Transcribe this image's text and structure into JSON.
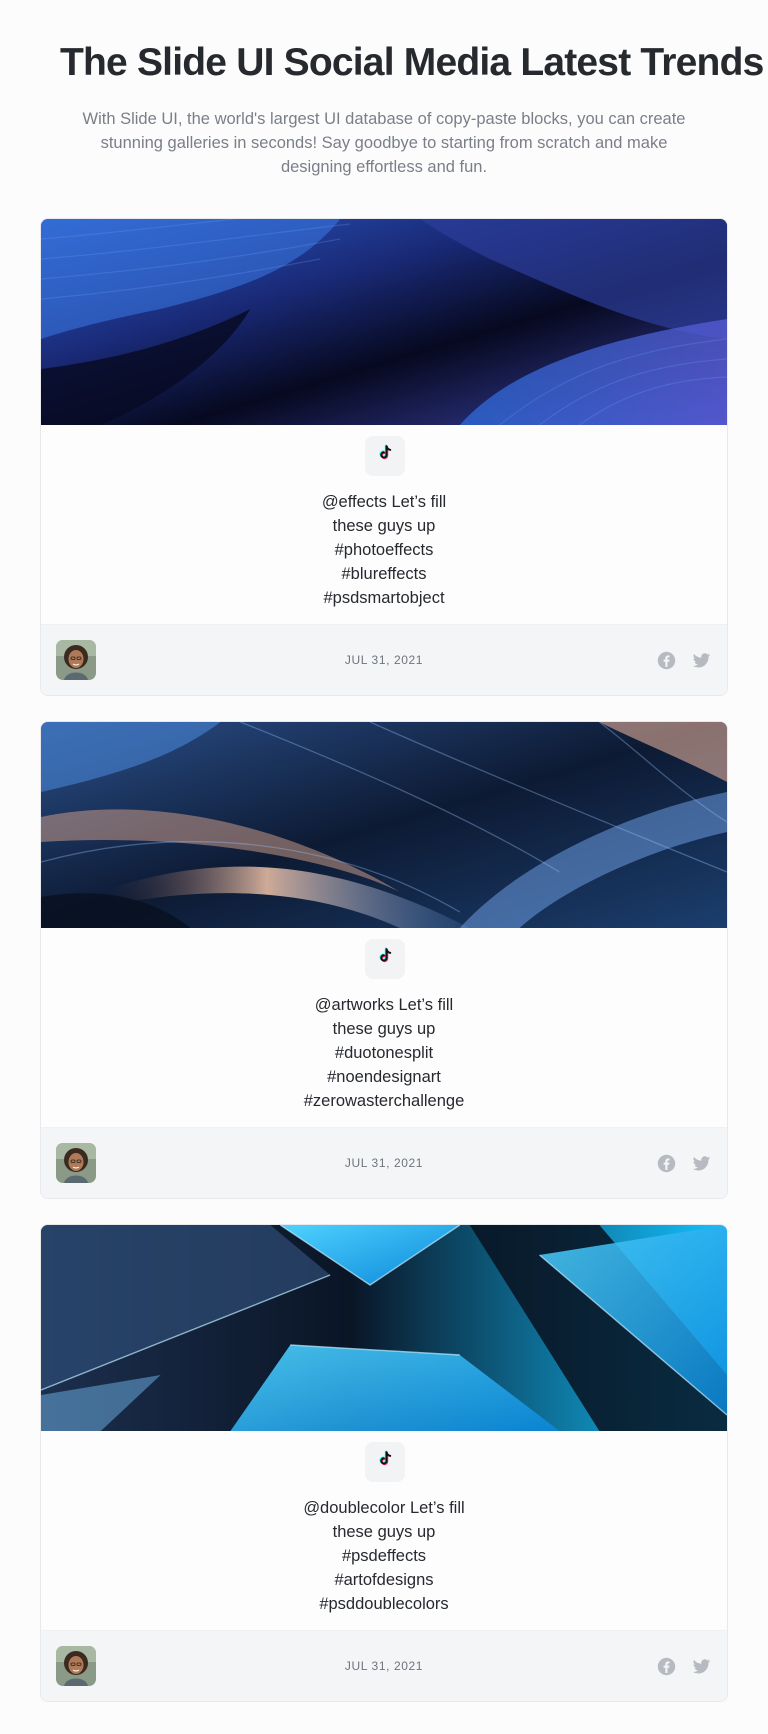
{
  "header": {
    "title": "The Slide UI Social Media Latest Trends",
    "subtitle": "With Slide UI, the world's largest UI database of copy-paste blocks, you can create stunning galleries in seconds! Say goodbye to starting from scratch and make designing effortless and fun."
  },
  "posts": [
    {
      "platform_icon": "tiktok-icon",
      "caption_lines": [
        "@effects Let’s fill",
        "these guys up",
        "#photoeffects",
        "#blureffects",
        "#psdsmartobject"
      ],
      "date": "JUL 31, 2021",
      "hero_theme": "blue-waves",
      "share_icons": [
        "facebook-icon",
        "twitter-icon"
      ]
    },
    {
      "platform_icon": "tiktok-icon",
      "caption_lines": [
        "@artworks Let’s fill",
        "these guys up",
        "#duotonesplit",
        "#noendesignart",
        "#zerowasterchallenge"
      ],
      "date": "JUL 31, 2021",
      "hero_theme": "dark-glass-streaks",
      "share_icons": [
        "facebook-icon",
        "twitter-icon"
      ]
    },
    {
      "platform_icon": "tiktok-icon",
      "caption_lines": [
        "@doublecolor Let’s fill",
        "these guys up",
        "#psdeffects",
        "#artofdesigns",
        "#psddoublecolors"
      ],
      "date": "JUL 31, 2021",
      "hero_theme": "cyan-shards",
      "share_icons": [
        "facebook-icon",
        "twitter-icon"
      ]
    }
  ],
  "colors": {
    "title": "#26292e",
    "subtitle": "#7a7f87",
    "footer_bg": "#f4f5f7",
    "icon_gray": "#b7bbc1"
  }
}
